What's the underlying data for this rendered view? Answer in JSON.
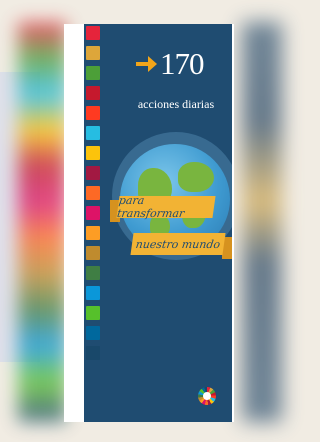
{
  "cover": {
    "number": "170",
    "subtitle": "acciones diarias",
    "ribbon_line_1": "para transformar",
    "ribbon_line_2": "nuestro mundo",
    "icons": [
      "arrow-right-icon",
      "globe-icon",
      "sdg-wheel-icon"
    ],
    "colors": {
      "cover_background": "#1f4c71",
      "accent_orange": "#f2a51a",
      "ribbon": "#f2b334"
    }
  },
  "sdg_strip": {
    "tile_colors": [
      "#e5243b",
      "#dda63a",
      "#4c9f38",
      "#c5192d",
      "#ff3a21",
      "#26bde2",
      "#fcc30b",
      "#a21942",
      "#fd6925",
      "#dd1367",
      "#fd9d24",
      "#bf8b2e",
      "#3f7e44",
      "#0a97d9",
      "#56c02b",
      "#00689d",
      "#19486a"
    ]
  }
}
